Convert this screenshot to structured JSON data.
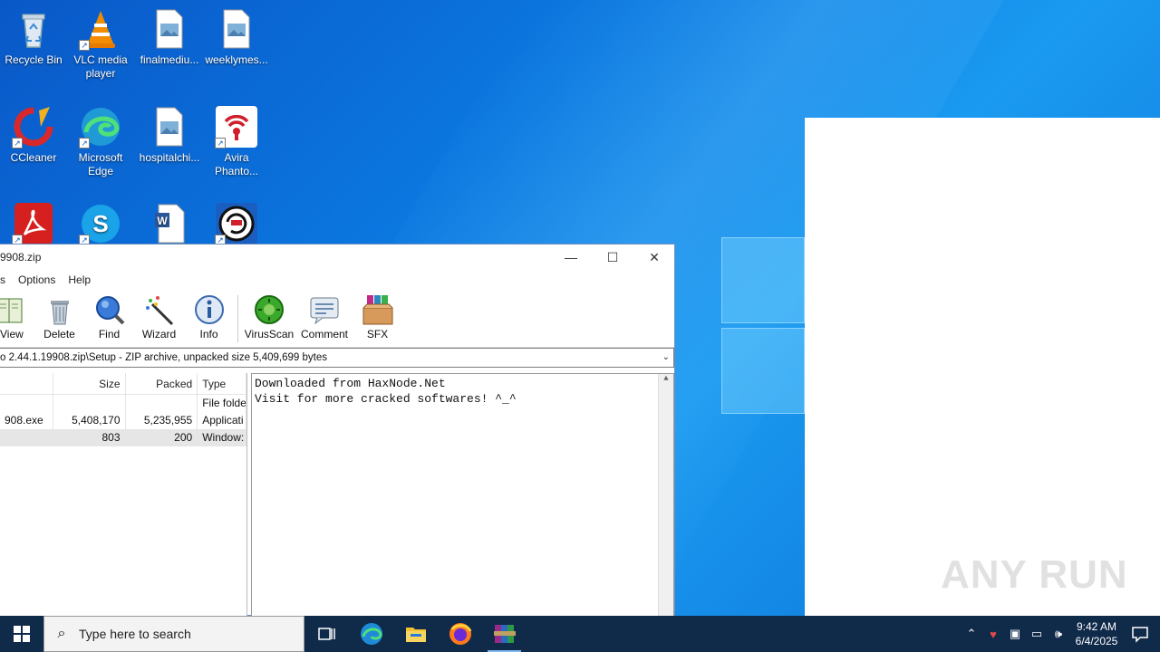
{
  "desktop": {
    "icons": [
      {
        "label": "Recycle Bin",
        "icon": "recycle-bin-icon"
      },
      {
        "label": "VLC media player",
        "icon": "vlc-icon"
      },
      {
        "label": "finalmediu...",
        "icon": "image-file-icon"
      },
      {
        "label": "weeklymes...",
        "icon": "image-file-icon"
      },
      {
        "label": "CCleaner",
        "icon": "ccleaner-icon"
      },
      {
        "label": "Microsoft Edge",
        "icon": "edge-icon"
      },
      {
        "label": "hospitalchi...",
        "icon": "image-file-icon"
      },
      {
        "label": "Avira Phanto...",
        "icon": "avira-icon"
      },
      {
        "label": "",
        "icon": "acrobat-icon"
      },
      {
        "label": "",
        "icon": "skype-icon"
      },
      {
        "label": "",
        "icon": "word-doc-icon"
      },
      {
        "label": "",
        "icon": "data-reset-icon"
      }
    ]
  },
  "window": {
    "title": "9908.zip",
    "menu": [
      "s",
      "Options",
      "Help"
    ],
    "toolbar": [
      {
        "label": "View",
        "icon": "view-book-icon"
      },
      {
        "label": "Delete",
        "icon": "trash-icon"
      },
      {
        "label": "Find",
        "icon": "magnifier-icon"
      },
      {
        "label": "Wizard",
        "icon": "wizard-wand-icon"
      },
      {
        "label": "Info",
        "icon": "info-icon"
      },
      {
        "label": "VirusScan",
        "icon": "virus-scan-icon"
      },
      {
        "label": "Comment",
        "icon": "comment-icon"
      },
      {
        "label": "SFX",
        "icon": "sfx-box-icon"
      }
    ],
    "path": "o 2.44.1.19908.zip\\Setup - ZIP archive, unpacked size 5,409,699 bytes",
    "columns": [
      "",
      "Size",
      "Packed",
      "Type"
    ],
    "rows": [
      {
        "name": "",
        "size": "",
        "packed": "",
        "type": "File folde"
      },
      {
        "name": "908.exe",
        "size": "5,408,170",
        "packed": "5,235,955",
        "type": "Applicati"
      },
      {
        "name": "",
        "size": "803",
        "packed": "200",
        "type": "Window:"
      }
    ],
    "comment": {
      "line1": "Downloaded from HaxNode.Net",
      "line2": "",
      "line3": "Visit for more cracked softwares! ^_^"
    }
  },
  "taskbar": {
    "search_placeholder": "Type here to search",
    "time": "9:42 AM",
    "date": "6/4/2025"
  },
  "watermark": "ANY RUN"
}
